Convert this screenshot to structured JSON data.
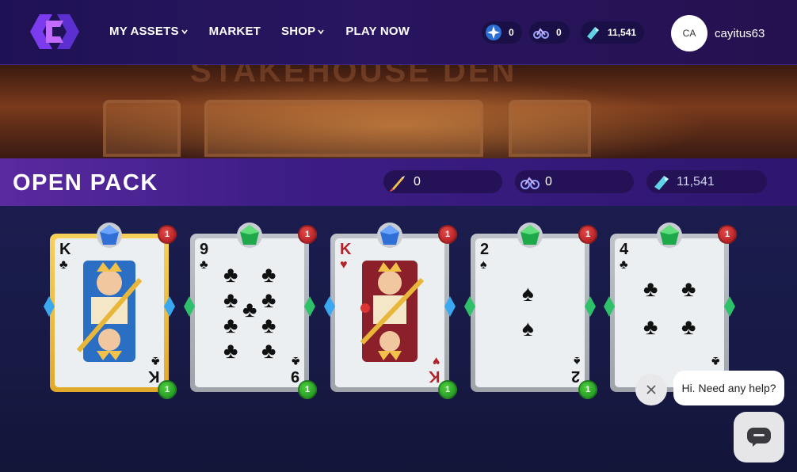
{
  "nav": {
    "items": [
      {
        "label": "MY ASSETS",
        "has_dropdown": true
      },
      {
        "label": "MARKET",
        "has_dropdown": false
      },
      {
        "label": "SHOP",
        "has_dropdown": true
      },
      {
        "label": "PLAY NOW",
        "has_dropdown": false
      }
    ]
  },
  "header_currencies": [
    {
      "icon": "star-token-icon",
      "value": "0"
    },
    {
      "icon": "bike-icon",
      "value": "0"
    },
    {
      "icon": "gem-icon",
      "value": "11,541"
    }
  ],
  "user": {
    "initials": "CA",
    "username": "cayitus63"
  },
  "banner": {
    "sign_text": "STAKEHOUSE DEN"
  },
  "open_pack": {
    "title": "OPEN PACK",
    "balances": [
      {
        "icon": "rocket-icon",
        "value": "0"
      },
      {
        "icon": "bike-icon",
        "value": "0"
      },
      {
        "icon": "gem-icon",
        "value": "11,541"
      }
    ]
  },
  "cards": [
    {
      "rank": "K",
      "suit": "♣",
      "suit_name": "clubs",
      "gem": "blue",
      "frame": "gold",
      "top_badge": "1",
      "bottom_badge": "1"
    },
    {
      "rank": "9",
      "suit": "♣",
      "suit_name": "clubs",
      "gem": "green",
      "frame": "silver",
      "top_badge": "1",
      "bottom_badge": "1"
    },
    {
      "rank": "K",
      "suit": "♥",
      "suit_name": "hearts",
      "gem": "blue",
      "frame": "silver",
      "top_badge": "1",
      "bottom_badge": "1"
    },
    {
      "rank": "2",
      "suit": "♠",
      "suit_name": "spades",
      "gem": "green",
      "frame": "silver",
      "top_badge": "1",
      "bottom_badge": "1"
    },
    {
      "rank": "4",
      "suit": "♣",
      "suit_name": "clubs",
      "gem": "green",
      "frame": "silver",
      "top_badge": "1",
      "bottom_badge": "1"
    }
  ],
  "chat": {
    "bubble_text": "Hi. Need any help?"
  },
  "colors": {
    "topbar": "#241357",
    "strip": "#3d1d86",
    "badge_red": "#c21f25",
    "badge_green": "#22a12a",
    "gem_blue": "#2f6fd6",
    "gem_green": "#1fa84a"
  }
}
